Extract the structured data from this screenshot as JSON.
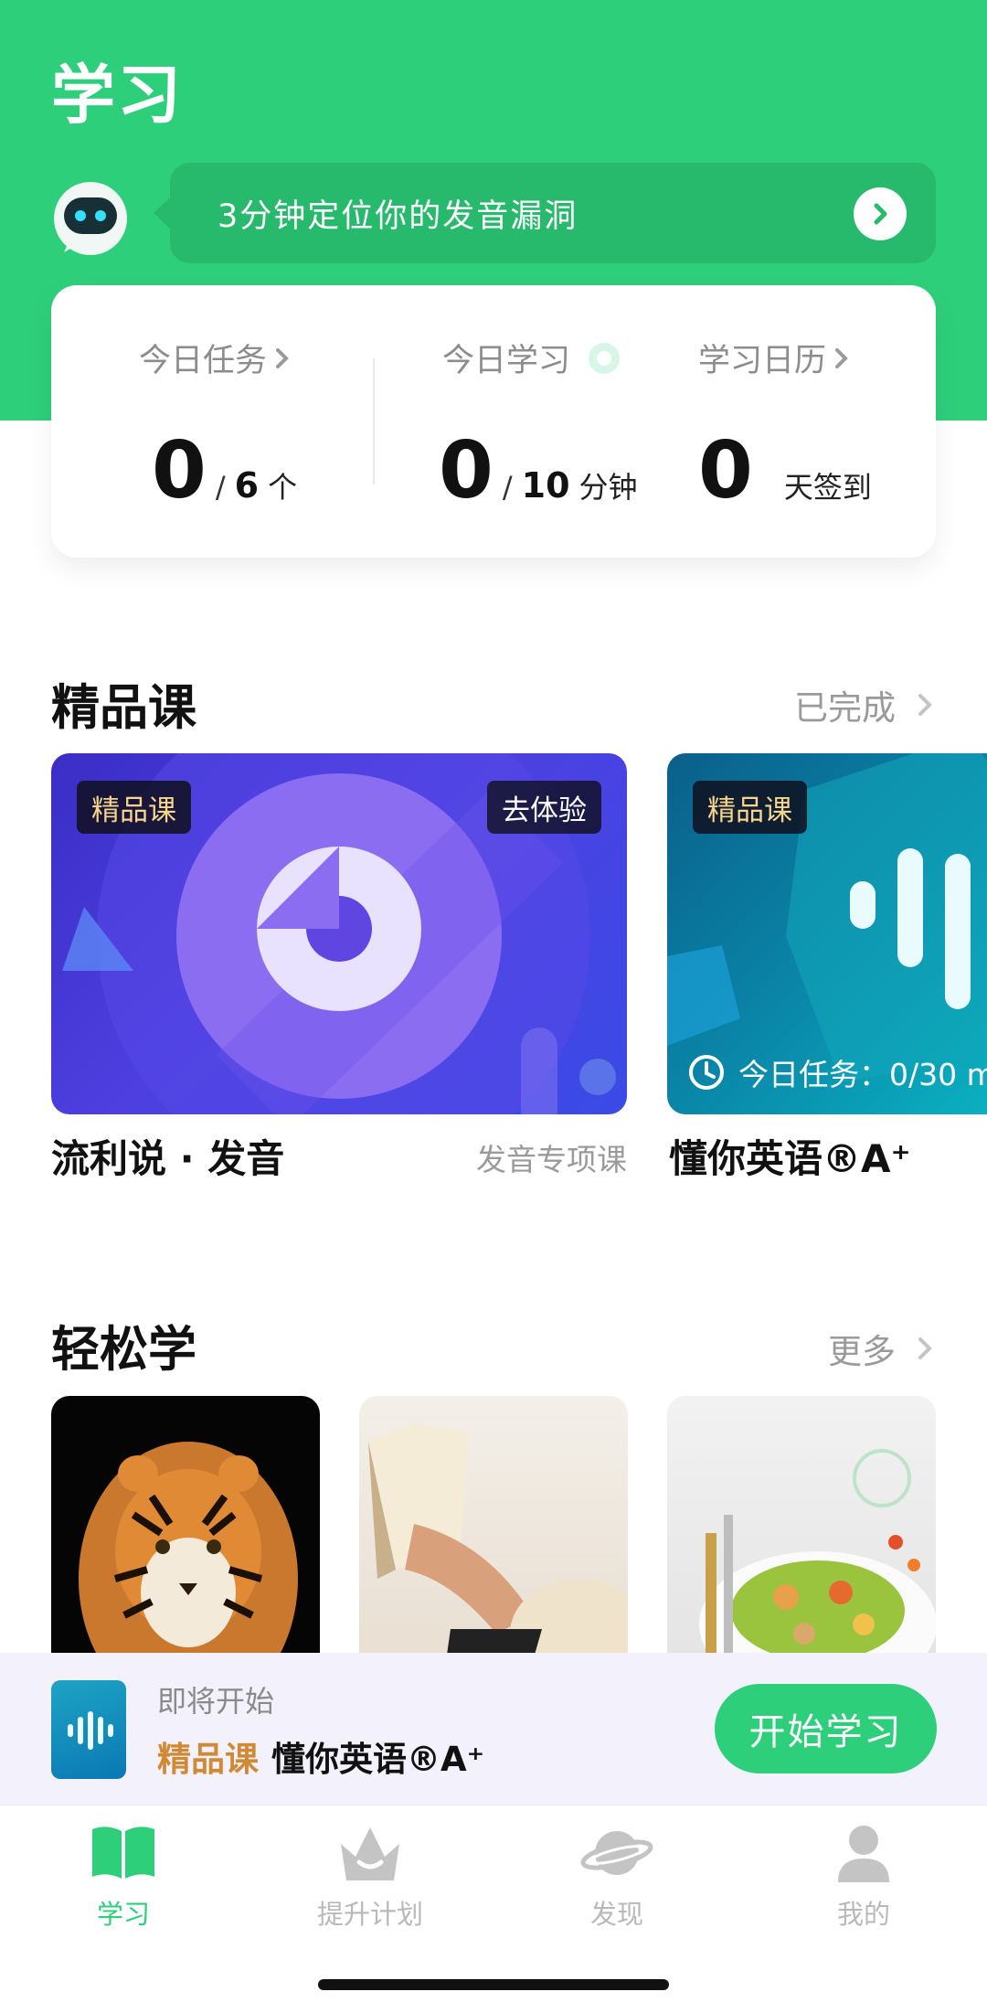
{
  "header": {
    "title": "学习",
    "banner_text": "3分钟定位你的发音漏洞",
    "accent": "#2ecf7b"
  },
  "stats": {
    "today_task": {
      "label": "今日任务",
      "done": "0",
      "total": "6",
      "unit": "个"
    },
    "today_study": {
      "label": "今日学习",
      "done": "0",
      "total": "10",
      "unit": "分钟"
    },
    "calendar": {
      "label": "学习日历",
      "days": "0",
      "unit": "天签到"
    }
  },
  "premium": {
    "title": "精品课",
    "more": "已完成",
    "cards": [
      {
        "tag": "精品课",
        "action": "去体验",
        "name": "流利说 · 发音",
        "sub": "发音专项课"
      },
      {
        "tag": "精品课",
        "task": "今日任务：0/30 m",
        "name": "懂你英语®A⁺"
      }
    ]
  },
  "easy": {
    "title": "轻松学",
    "more": "更多",
    "thumbs": [
      "tiger",
      "reading",
      "salad"
    ]
  },
  "upcoming": {
    "label": "即将开始",
    "tag": "精品课",
    "name": "懂你英语®A⁺",
    "button": "开始学习"
  },
  "tabs": [
    {
      "label": "学习",
      "icon": "book-icon",
      "active": true
    },
    {
      "label": "提升计划",
      "icon": "crown-icon",
      "active": false
    },
    {
      "label": "发现",
      "icon": "planet-icon",
      "active": false
    },
    {
      "label": "我的",
      "icon": "user-icon",
      "active": false
    }
  ]
}
